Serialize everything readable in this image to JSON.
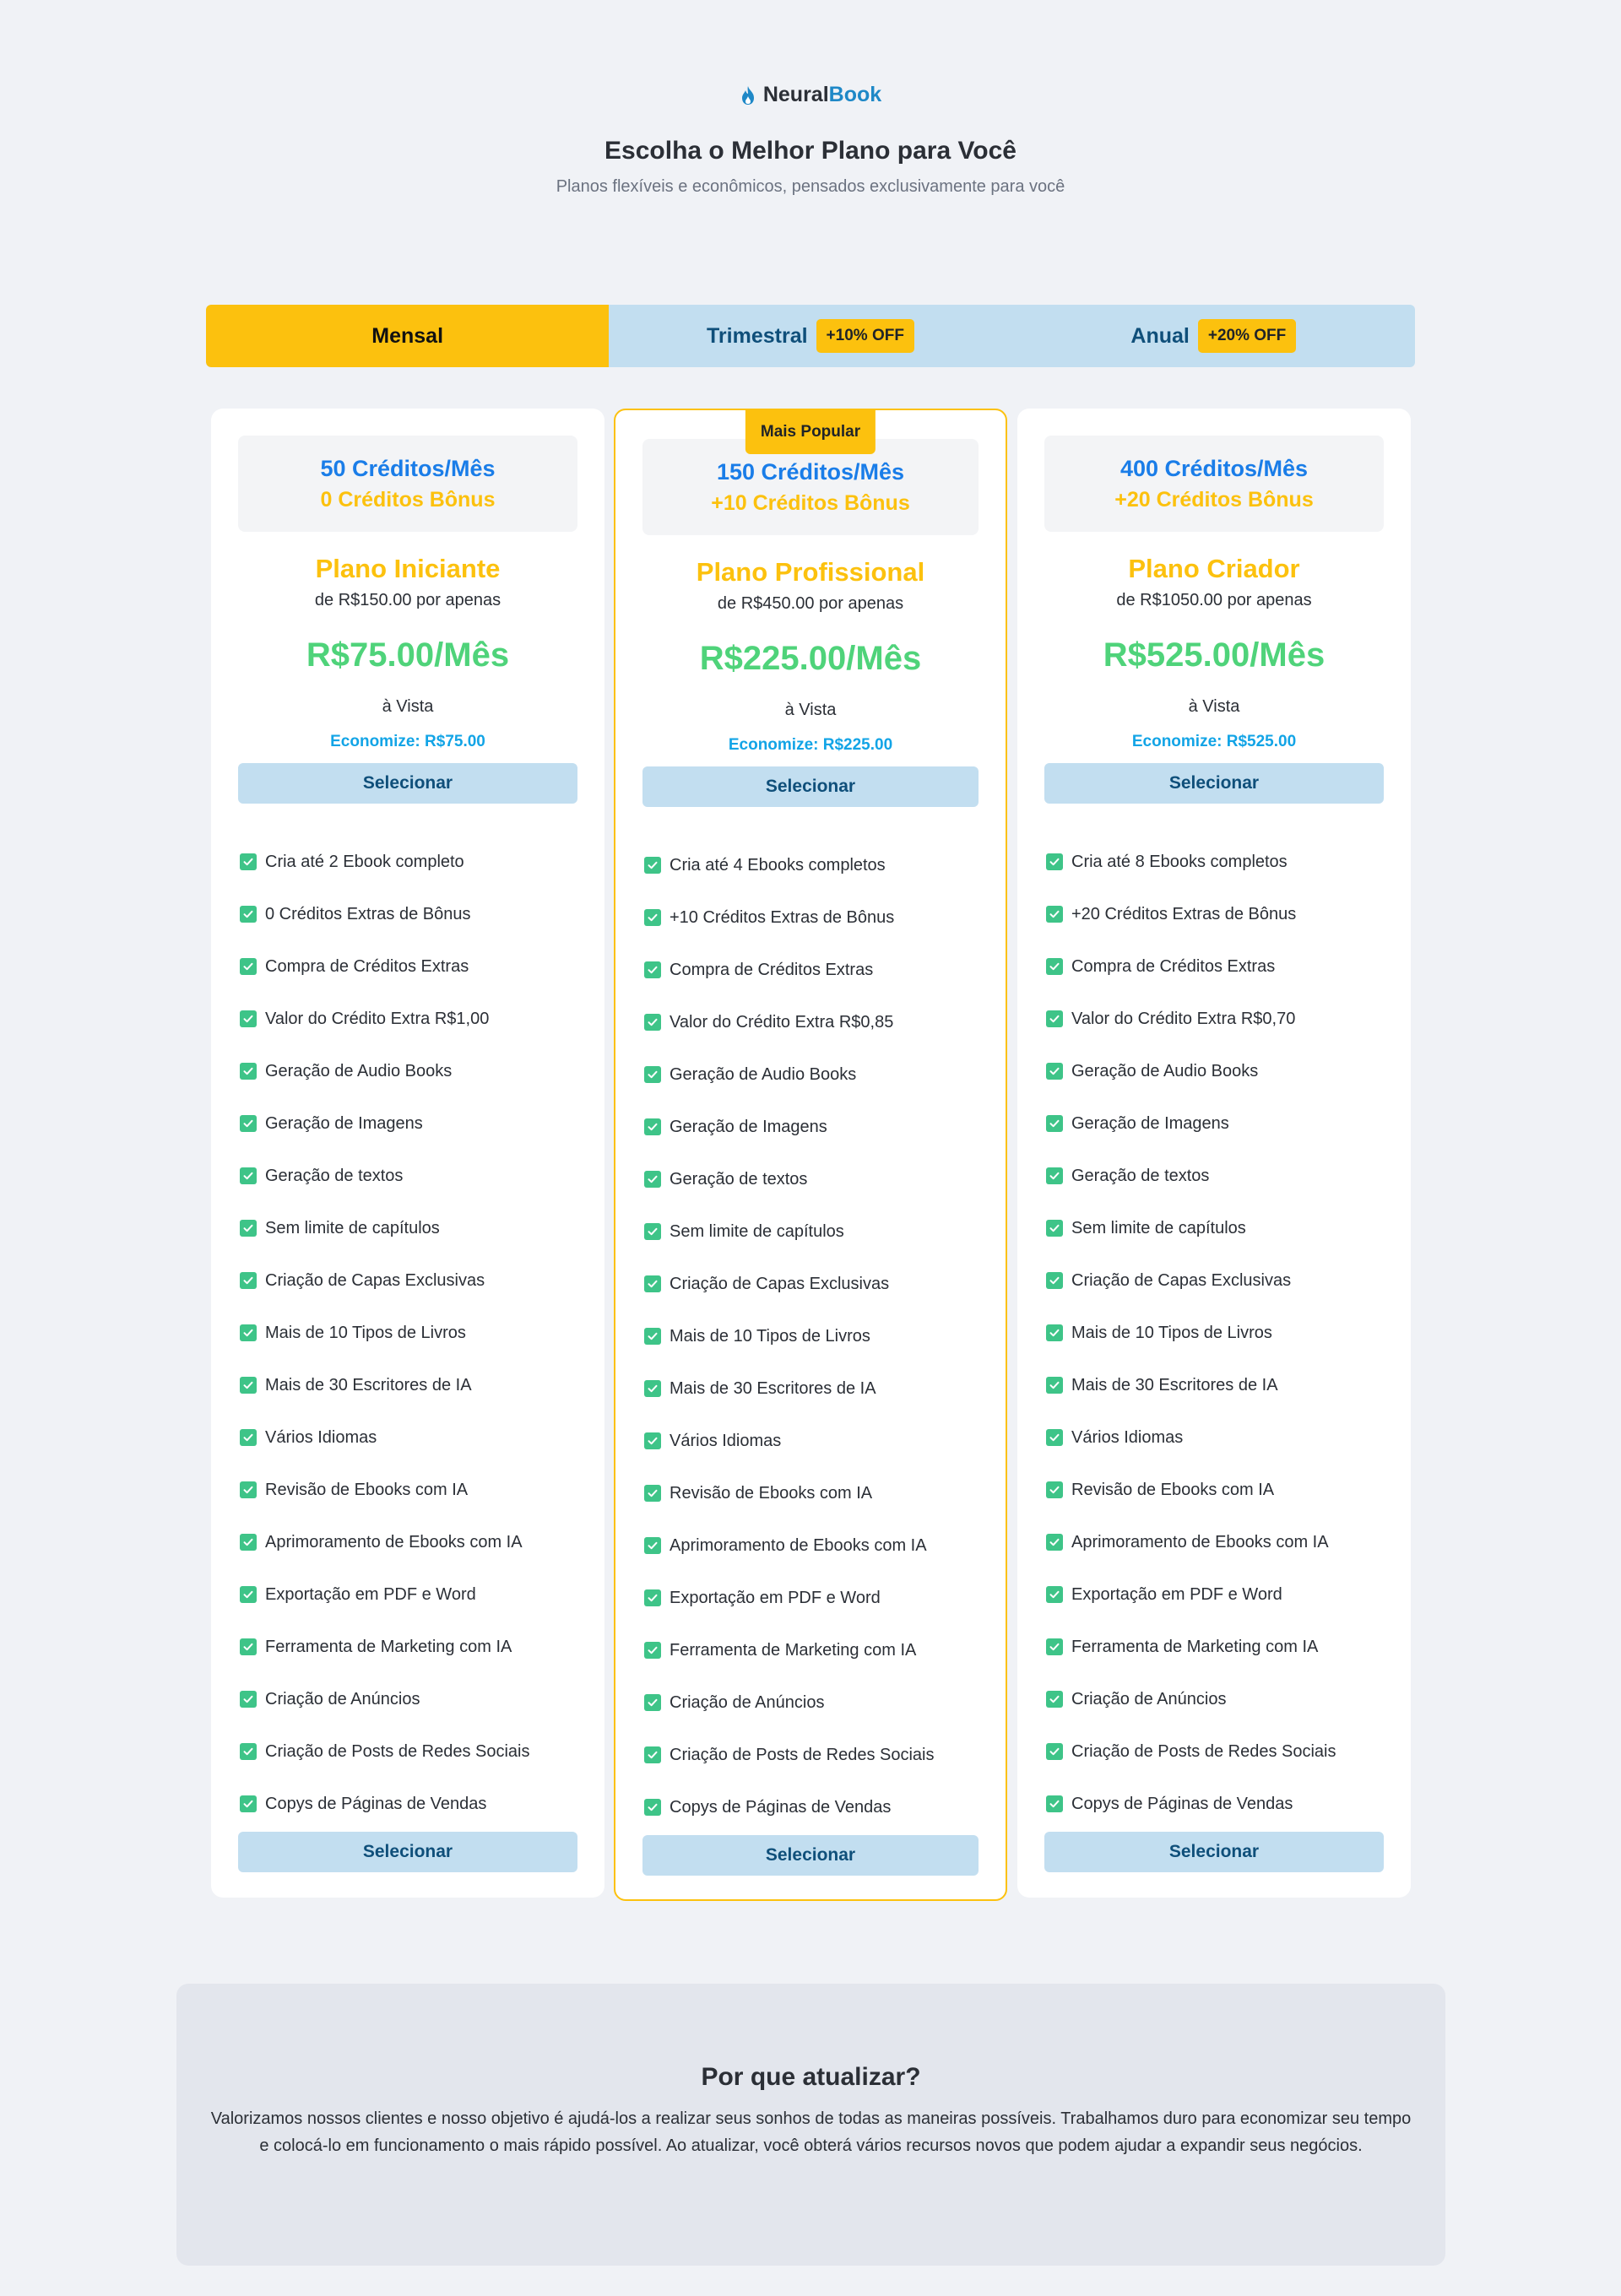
{
  "brand": {
    "part1": "Neural",
    "part2": "Book"
  },
  "header": {
    "title": "Escolha o Melhor Plano para Você",
    "subtitle": "Planos flexíveis e econômicos, pensados exclusivamente para você"
  },
  "billing": {
    "selected": "Mensal",
    "options": [
      {
        "label": "Mensal"
      },
      {
        "label": "Trimestral",
        "badge": "+10% OFF"
      },
      {
        "label": "Anual",
        "badge": "+20% OFF"
      }
    ]
  },
  "select_label": "Selecionar",
  "popular_badge": "Mais Popular",
  "plans": [
    {
      "credits": "50 Créditos/Mês",
      "bonus": "0 Créditos Bônus",
      "name": "Plano Iniciante",
      "from": "de R$150.00 por apenas",
      "price": "R$75.00/Mês",
      "payment": "à Vista",
      "savings": "Economize: R$75.00",
      "features": [
        "Cria até 2 Ebook completo",
        "0 Créditos Extras de Bônus",
        "Compra de Créditos Extras",
        "Valor do Crédito Extra R$1,00",
        "Geração de Audio Books",
        "Geração de Imagens",
        "Geração de textos",
        "Sem limite de capítulos",
        "Criação de Capas Exclusivas",
        "Mais de 10 Tipos de Livros",
        "Mais de 30 Escritores de IA",
        "Vários Idiomas",
        "Revisão de Ebooks com IA",
        "Aprimoramento de Ebooks com IA",
        "Exportação em PDF e Word",
        "Ferramenta de Marketing com IA",
        "Criação de Anúncios",
        "Criação de Posts de Redes Sociais",
        "Copys de Páginas de Vendas"
      ]
    },
    {
      "credits": "150 Créditos/Mês",
      "bonus": "+10 Créditos Bônus",
      "name": "Plano Profissional",
      "from": "de R$450.00 por apenas",
      "price": "R$225.00/Mês",
      "payment": "à Vista",
      "savings": "Economize: R$225.00",
      "features": [
        "Cria até 4 Ebooks completos",
        "+10 Créditos Extras de Bônus",
        "Compra de Créditos Extras",
        "Valor do Crédito Extra R$0,85",
        "Geração de Audio Books",
        "Geração de Imagens",
        "Geração de textos",
        "Sem limite de capítulos",
        "Criação de Capas Exclusivas",
        "Mais de 10 Tipos de Livros",
        "Mais de 30 Escritores de IA",
        "Vários Idiomas",
        "Revisão de Ebooks com IA",
        "Aprimoramento de Ebooks com IA",
        "Exportação em PDF e Word",
        "Ferramenta de Marketing com IA",
        "Criação de Anúncios",
        "Criação de Posts de Redes Sociais",
        "Copys de Páginas de Vendas"
      ]
    },
    {
      "credits": "400 Créditos/Mês",
      "bonus": "+20 Créditos Bônus",
      "name": "Plano Criador",
      "from": "de R$1050.00 por apenas",
      "price": "R$525.00/Mês",
      "payment": "à Vista",
      "savings": "Economize: R$525.00",
      "features": [
        "Cria até 8 Ebooks completos",
        "+20 Créditos Extras de Bônus",
        "Compra de Créditos Extras",
        "Valor do Crédito Extra R$0,70",
        "Geração de Audio Books",
        "Geração de Imagens",
        "Geração de textos",
        "Sem limite de capítulos",
        "Criação de Capas Exclusivas",
        "Mais de 10 Tipos de Livros",
        "Mais de 30 Escritores de IA",
        "Vários Idiomas",
        "Revisão de Ebooks com IA",
        "Aprimoramento de Ebooks com IA",
        "Exportação em PDF e Word",
        "Ferramenta de Marketing com IA",
        "Criação de Anúncios",
        "Criação de Posts de Redes Sociais",
        "Copys de Páginas de Vendas"
      ]
    }
  ],
  "why": {
    "title": "Por que atualizar?",
    "text": "Valorizamos nossos clientes e nosso objetivo é ajudá-los a realizar seus sonhos de todas as maneiras possíveis. Trabalhamos duro para economizar seu tempo e colocá-lo em funcionamento o mais rápido possível. Ao atualizar, você obterá vários recursos novos que podem ajudar a expandir seus negócios."
  },
  "colors": {
    "accent_yellow": "#fcc10e",
    "brand_blue": "#1e88c7",
    "credits_blue": "#1a7de8",
    "price_green": "#4fd37a",
    "savings_blue": "#12a4e6",
    "check_green": "#3ec488",
    "button_bg": "#c2def0"
  },
  "icons": {
    "brand": "flame-icon",
    "feature": "check-icon"
  }
}
